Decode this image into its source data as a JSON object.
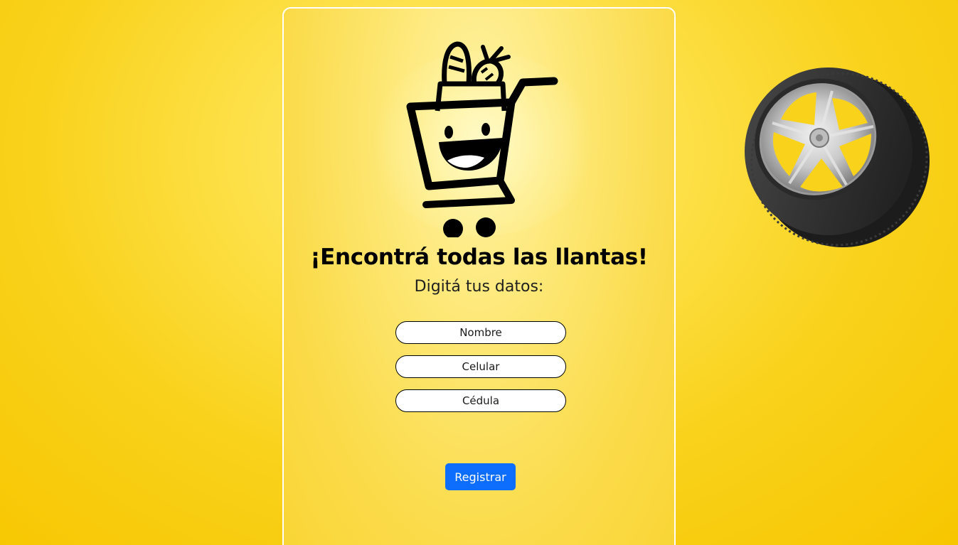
{
  "main": {
    "headline": "¡Encontrá todas las llantas!",
    "subtitle": "Digitá tus datos:"
  },
  "form": {
    "fields": [
      {
        "placeholder": "Nombre",
        "value": ""
      },
      {
        "placeholder": "Celular",
        "value": ""
      },
      {
        "placeholder": "Cédula",
        "value": ""
      }
    ],
    "submit_label": "Registrar"
  },
  "icons": {
    "logo": "shopping-cart-mascot-icon",
    "decoration": "tire-icon"
  },
  "colors": {
    "background": "#f9d21c",
    "button": "#0d6efd",
    "card_border": "#ffffff"
  }
}
